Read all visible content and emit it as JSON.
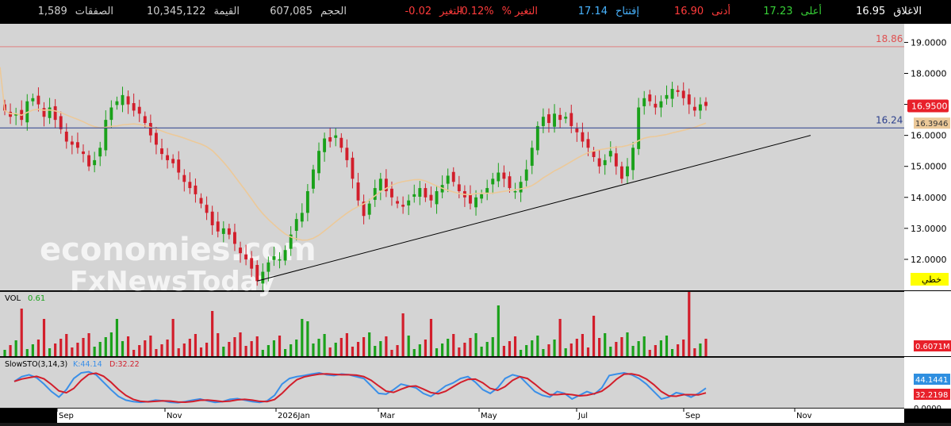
{
  "top_bar": [
    {
      "label": "الاغلاق",
      "value": "16.95",
      "label_color": "#ffffff",
      "value_color": "#ffffff"
    },
    {
      "label": "أعلى",
      "value": "17.23",
      "label_color": "#37d037",
      "value_color": "#37d037"
    },
    {
      "label": "أدنى",
      "value": "16.90",
      "label_color": "#ff3b3b",
      "value_color": "#ff3b3b"
    },
    {
      "label": "إفتتاح",
      "value": "17.14",
      "label_color": "#48b4ff",
      "value_color": "#48b4ff"
    },
    {
      "label": "التغير %",
      "value": "-0.12%",
      "label_color": "#ff3b3b",
      "value_color": "#ff3b3b"
    },
    {
      "label": "التغير",
      "value": "-0.02",
      "label_color": "#ff3b3b",
      "value_color": "#ff3b3b"
    },
    {
      "label": "الحجم",
      "value": "607,085",
      "label_color": "#cfcfcf",
      "value_color": "#cfcfcf"
    },
    {
      "label": "القيمة",
      "value": "10,345,122",
      "label_color": "#cfcfcf",
      "value_color": "#cfcfcf"
    },
    {
      "label": "الصفقات",
      "value": "1,589",
      "label_color": "#cfcfcf",
      "value_color": "#cfcfcf"
    }
  ],
  "watermark": {
    "line1": "economies.com",
    "line2": "FxNewsToday"
  },
  "colors": {
    "up": "#1aa11a",
    "down": "#d21e2b",
    "background": "#d4d4d4",
    "ma": "#ecc999",
    "resistance": "#e08080",
    "support": "#2a3e8c",
    "trendline": "#000000",
    "k_line": "#3a8fe8",
    "d_line": "#d21e2b"
  },
  "chart_data": [
    {
      "type": "candlestick",
      "x_ticks": [
        "Sep",
        "Nov",
        "2026Jan",
        "Mar",
        "May",
        "Jul",
        "Sep",
        "Nov"
      ],
      "y_ticks": [
        "19.0000",
        "18.0000",
        "17.0000",
        "16.0000",
        "15.0000",
        "14.0000",
        "13.0000",
        "12.0000"
      ],
      "ylim": [
        11.0,
        19.6
      ],
      "approx_closes": [
        16.8,
        16.6,
        16.7,
        16.5,
        17.1,
        17.2,
        17.0,
        16.6,
        16.9,
        16.5,
        16.2,
        15.8,
        15.7,
        15.6,
        15.4,
        15.0,
        15.2,
        15.6,
        16.5,
        16.9,
        17.1,
        17.3,
        17.0,
        16.8,
        16.7,
        16.4,
        16.0,
        15.7,
        15.4,
        15.2,
        15.1,
        14.8,
        14.5,
        14.3,
        14.1,
        13.8,
        13.5,
        13.1,
        12.9,
        13.0,
        12.8,
        12.5,
        12.2,
        12.0,
        11.7,
        11.3,
        11.6,
        11.9,
        12.1,
        12.0,
        12.3,
        12.8,
        13.3,
        13.5,
        14.2,
        14.9,
        15.5,
        15.9,
        15.8,
        16.0,
        15.6,
        15.2,
        14.6,
        13.9,
        13.4,
        13.8,
        14.3,
        14.6,
        14.2,
        14.0,
        13.8,
        13.7,
        13.9,
        14.1,
        14.3,
        14.0,
        13.9,
        14.2,
        14.4,
        14.7,
        14.5,
        14.2,
        14.0,
        13.8,
        14.0,
        14.1,
        14.3,
        14.6,
        14.8,
        14.6,
        14.3,
        14.2,
        14.5,
        14.9,
        15.6,
        16.3,
        16.6,
        16.4,
        16.7,
        16.5,
        16.6,
        16.3,
        16.1,
        15.8,
        15.6,
        15.3,
        15.0,
        15.2,
        15.5,
        15.0,
        14.6,
        15.0,
        15.6,
        16.9,
        17.2,
        17.1,
        16.9,
        17.1,
        17.3,
        17.5,
        17.4,
        17.2,
        17.0,
        16.8,
        17.0,
        16.95
      ],
      "resistance": 18.86,
      "support": 16.24,
      "moving_average_last": 16.3946,
      "last_price": 16.95,
      "scale_label": "خطي"
    },
    {
      "type": "bar",
      "title": "VOL",
      "title_value": "0.61",
      "last_value_label": "0.6071M"
    },
    {
      "type": "line",
      "title": "SlowSTO(3,14,3)",
      "series": [
        {
          "name": "K",
          "label": "K:44.14",
          "last": 44.1441
        },
        {
          "name": "D",
          "label": "D:32.22",
          "last": 32.2198
        }
      ],
      "y_tick": "0.0000",
      "k_values": [
        62,
        75,
        80,
        72,
        55,
        35,
        20,
        40,
        70,
        85,
        88,
        80,
        60,
        40,
        22,
        12,
        8,
        6,
        8,
        12,
        10,
        6,
        5,
        8,
        12,
        15,
        10,
        6,
        8,
        14,
        16,
        12,
        8,
        6,
        10,
        25,
        55,
        70,
        75,
        78,
        82,
        85,
        80,
        78,
        82,
        80,
        75,
        70,
        50,
        30,
        28,
        40,
        55,
        50,
        45,
        30,
        22,
        35,
        50,
        58,
        70,
        75,
        60,
        40,
        30,
        45,
        70,
        80,
        75,
        55,
        35,
        25,
        20,
        35,
        30,
        15,
        25,
        35,
        28,
        45,
        78,
        82,
        85,
        80,
        70,
        55,
        35,
        15,
        20,
        32,
        28,
        20,
        30,
        44
      ]
    }
  ]
}
